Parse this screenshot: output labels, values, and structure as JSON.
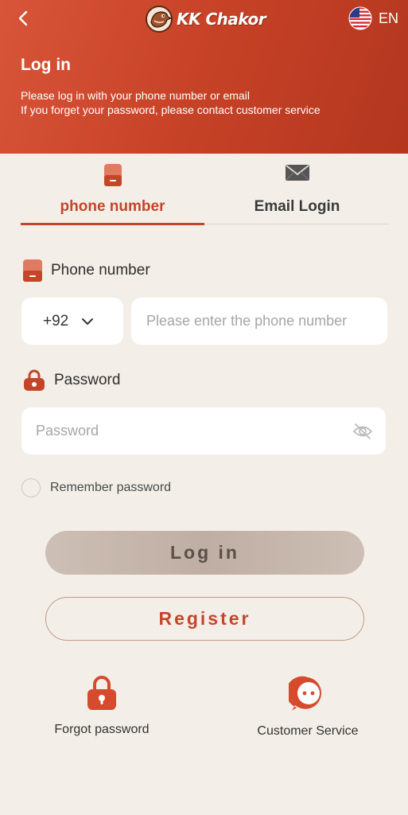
{
  "header": {
    "brand": "KK Chakor",
    "language": "EN",
    "title": "Log in",
    "subtitle_line1": "Please log in with your phone number or email",
    "subtitle_line2": "If you forget your password, please contact customer service"
  },
  "tabs": [
    {
      "label": "phone number",
      "icon": "phone-icon",
      "active": true
    },
    {
      "label": "Email Login",
      "icon": "envelope-icon",
      "active": false
    }
  ],
  "phone": {
    "label": "Phone number",
    "country_code": "+92",
    "placeholder": "Please enter the phone number"
  },
  "password": {
    "label": "Password",
    "placeholder": "Password"
  },
  "remember_label": "Remember password",
  "buttons": {
    "login": "Log in",
    "register": "Register"
  },
  "footer": {
    "forgot": "Forgot password",
    "service": "Customer Service"
  },
  "colors": {
    "accent": "#c5452a",
    "header_start": "#d9553a",
    "header_end": "#b3361f",
    "background": "#f3efe8"
  }
}
